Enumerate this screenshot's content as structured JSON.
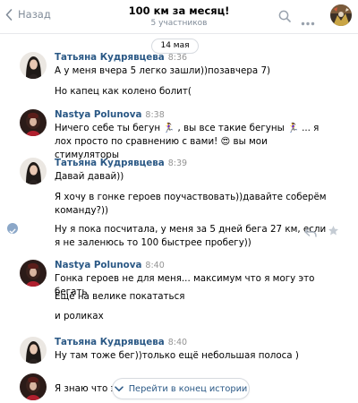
{
  "header": {
    "back_label": "Назад",
    "title": "100 км за месяц!",
    "subtitle": "5 участников",
    "icons": [
      "back-icon",
      "search-icon",
      "more-icon",
      "chat-avatar"
    ]
  },
  "date_separator": "14 мая",
  "messages": [
    {
      "author": "Татьяна Кудрявцева",
      "time": "8:36",
      "lines": [
        "А у меня вчера 5 легко зашли))позавчера 7)",
        "Но капец как колено болит("
      ]
    },
    {
      "author": "Nastya Polunova",
      "time": "8:38",
      "lines": [
        "Ничего себе ты бегун 🏃‍♀️ , вы все такие бегуны 🏃‍♀️ ... я лох просто по сравнению с вами! 😍 вы мои стимуляторы"
      ]
    },
    {
      "author": "Татьяна Кудрявцева",
      "time": "8:39",
      "lines": [
        "Давай давай))",
        "Я хочу в гонке героев поучаствовать))давайте соберём команду?))",
        "Ну я пока посчитала, у меня за 5 дней бега 27 км, если я не заленюсь то 100 быстрее пробегу))"
      ]
    },
    {
      "author": "Nastya Polunova",
      "time": "8:40",
      "lines": [
        "Гонка героев не для меня... максимум что я могу это бегать",
        "Ещё на велике покататься",
        "и роликах"
      ]
    },
    {
      "author": "Татьяна Кудрявцева",
      "time": "8:40",
      "lines": [
        "Ну там тоже бег))только ещё небольшая полоса )"
      ]
    },
    {
      "author": "Nastya Polunova",
      "time": "8:40",
      "lines": [
        "Я знаю что эт"
      ]
    }
  ],
  "scroll_button_label": "Перейти в конец истории",
  "colors": {
    "link": "#2a5885",
    "muted": "#818c99",
    "time": "#939393",
    "border": "#e7e8ec"
  }
}
